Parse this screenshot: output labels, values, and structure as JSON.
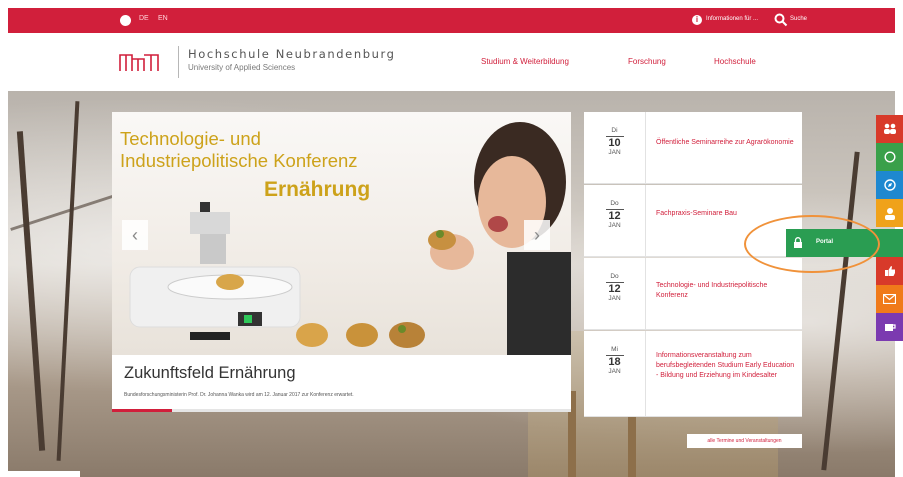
{
  "topbar": {
    "lang_de": "DE",
    "lang_en": "EN",
    "info_label": "Informationen für ...",
    "search_label": "Suche",
    "icons": [
      "globe-icon",
      "info-icon",
      "search-icon"
    ]
  },
  "header": {
    "title": "Hochschule Neubrandenburg",
    "subtitle": "University of Applied Sciences",
    "nav": [
      "Studium & Weiterbildung",
      "Forschung",
      "Hochschule"
    ]
  },
  "slider": {
    "headline_line1": "Technologie- und",
    "headline_line2": "Industriepolitische Konferenz",
    "headline_line3": "Ernährung",
    "title": "Zukunftsfeld Ernährung",
    "description": "Bundesforschungsministerin Prof. Dr. Johanna Wanka wird am 12. Januar 2017 zur Konferenz erwartet.",
    "prev": "‹",
    "next": "›",
    "progress": 0.13
  },
  "events": [
    {
      "dow": "Di",
      "day": "10",
      "mon": "JAN",
      "title": "Öffentliche Seminarreihe zur Agrarökonomie"
    },
    {
      "dow": "Do",
      "day": "12",
      "mon": "JAN",
      "title": "Fachpraxis-Seminare Bau"
    },
    {
      "dow": "Do",
      "day": "12",
      "mon": "JAN",
      "title": "Technologie- und Industriepolitische Konferenz"
    },
    {
      "dow": "Mi",
      "day": "18",
      "mon": "JAN",
      "title": "Informationsveranstaltung zum berufsbegleitenden Studium Early Education - Bildung und Erziehung im Kindesalter"
    }
  ],
  "all_events": "alle Termine und Veranstaltungen",
  "portal_label": "Portal",
  "colors": {
    "brand_red": "#d11f3b",
    "gold": "#cda21a",
    "portal_green": "#2a9d52",
    "highlight_orange": "#f0923a"
  },
  "side_icons": [
    "people-icon",
    "whatsapp-icon",
    "compass-icon",
    "person-icon",
    "lock-icon",
    "thumbs-up-icon",
    "mail-icon",
    "coffee-icon"
  ]
}
